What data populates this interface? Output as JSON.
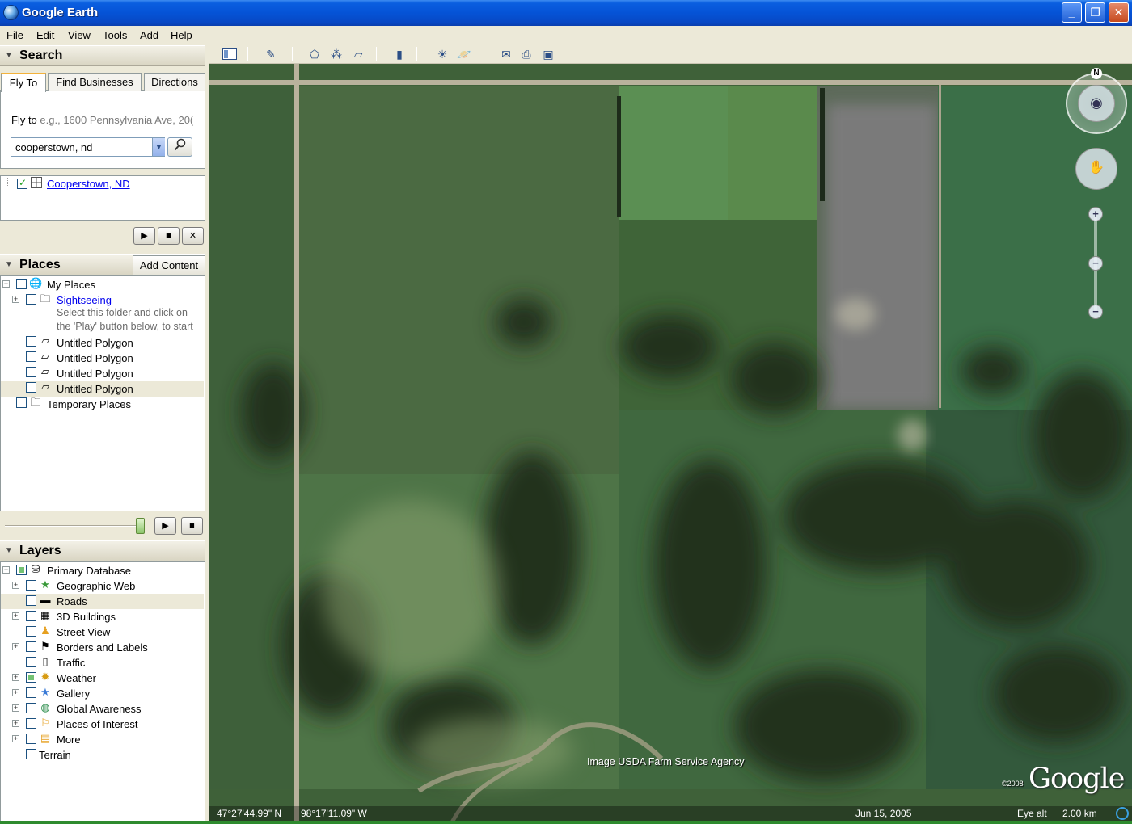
{
  "window": {
    "title": "Google Earth"
  },
  "menu": [
    "File",
    "Edit",
    "View",
    "Tools",
    "Add",
    "Help"
  ],
  "search": {
    "header": "Search",
    "tabs": [
      "Fly To",
      "Find Businesses",
      "Directions"
    ],
    "flyto_label": "Fly to",
    "flyto_hint": "e.g., 1600 Pennsylvania Ave, 20(",
    "query": "cooperstown, nd",
    "result": "Cooperstown, ND"
  },
  "places": {
    "header": "Places",
    "add_content": "Add Content",
    "items": {
      "my_places": "My Places",
      "sightseeing": "Sightseeing",
      "sightseeing_desc_1": "Select this folder and click on",
      "sightseeing_desc_2": "the 'Play' button below, to start",
      "poly1": "Untitled Polygon",
      "poly2": "Untitled Polygon",
      "poly3": "Untitled Polygon",
      "poly4": "Untitled Polygon",
      "temporary": "Temporary Places"
    }
  },
  "layers": {
    "header": "Layers",
    "items": {
      "primary": "Primary Database",
      "geoweb": "Geographic Web",
      "roads": "Roads",
      "buildings": "3D Buildings",
      "streetview": "Street View",
      "borders": "Borders and Labels",
      "traffic": "Traffic",
      "weather": "Weather",
      "gallery": "Gallery",
      "global": "Global Awareness",
      "poi": "Places of Interest",
      "more": "More",
      "terrain": "Terrain"
    }
  },
  "map": {
    "attribution": "Image USDA Farm Service Agency",
    "copyright": "©2008",
    "logo": "Google",
    "north": "N",
    "lat": "47°27'44.99\" N",
    "lon": "98°17'11.09\" W",
    "date": "Jun 15, 2005",
    "eye_alt_label": "Eye alt",
    "eye_alt_value": "2.00 km"
  },
  "icons": {
    "play": "▶",
    "stop": "■",
    "close": "✕",
    "search": "⚲"
  }
}
